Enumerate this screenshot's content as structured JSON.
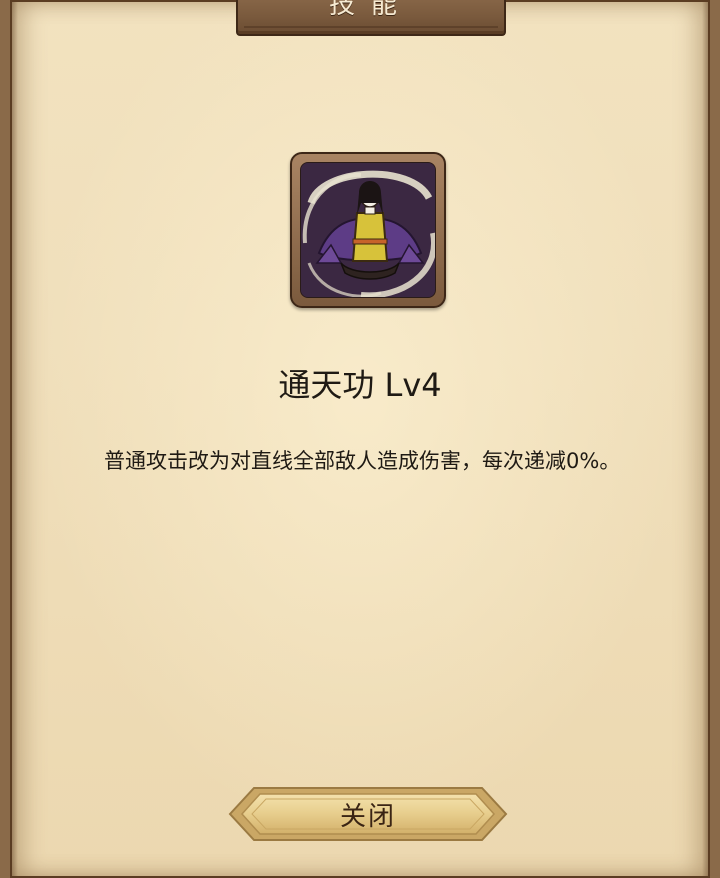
{
  "dialog": {
    "title": "技能"
  },
  "skill": {
    "icon": "meditating-swordsman-icon",
    "name": "通天功 Lv4",
    "description": "普通攻击改为对直线全部敌人造成伤害，每次递减0%。"
  },
  "actions": {
    "close_label": "关闭"
  },
  "colors": {
    "parchment": "#f0dfbb",
    "wood": "#7a5a3d",
    "text": "#1f1a14",
    "button_gold": "#e8cf8e"
  }
}
